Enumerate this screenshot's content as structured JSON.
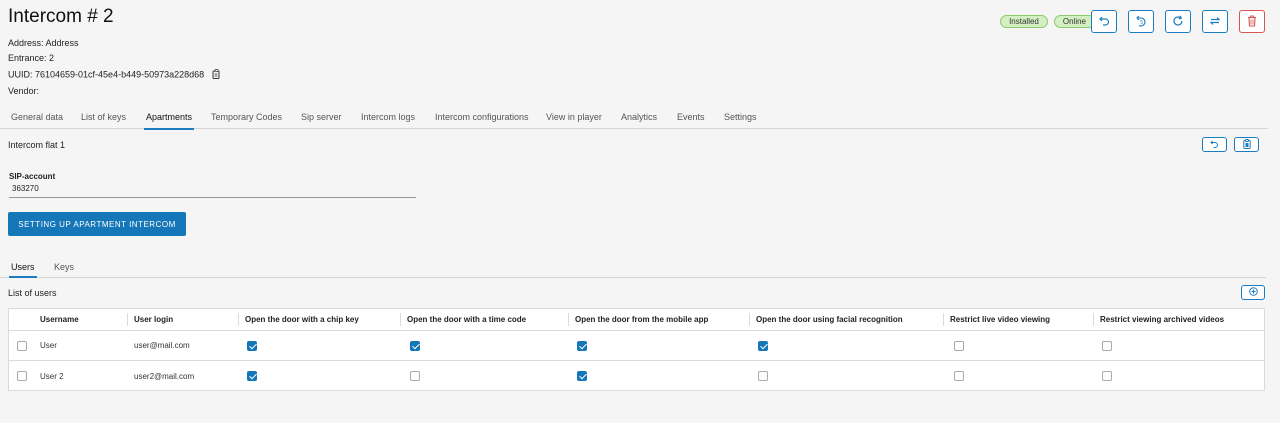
{
  "header": {
    "title": "Intercom # 2",
    "address": "Address: Address",
    "entrance": "Entrance: 2",
    "uuid": "UUID: 76104659-01cf-45e4-b449-50973a228d68",
    "vendor": "Vendor:",
    "status_installed": "Installed",
    "status_online": "Online"
  },
  "tabs": [
    {
      "label": "General data"
    },
    {
      "label": "List of keys"
    },
    {
      "label": "Apartments",
      "active": true
    },
    {
      "label": "Temporary Codes"
    },
    {
      "label": "Sip server"
    },
    {
      "label": "Intercom logs"
    },
    {
      "label": "Intercom configurations"
    },
    {
      "label": "View in player"
    },
    {
      "label": "Analytics"
    },
    {
      "label": "Events"
    },
    {
      "label": "Settings"
    }
  ],
  "flat": {
    "title": "Intercom flat 1",
    "sip_label": "SIP-account",
    "sip_value": "363270",
    "setup_button": "SETTING UP APARTMENT INTERCOM"
  },
  "subtabs": [
    {
      "label": "Users",
      "active": true
    },
    {
      "label": "Keys"
    }
  ],
  "users": {
    "list_title": "List of users",
    "columns": [
      "Username",
      "User login",
      "Open the door with a chip key",
      "Open the door with a time code",
      "Open the door from the mobile app",
      "Open the door using facial recognition",
      "Restrict live video viewing",
      "Restrict viewing archived videos"
    ],
    "rows": [
      {
        "username": "User",
        "login": "user@mail.com",
        "chip": true,
        "time_code": true,
        "mobile": true,
        "face": true,
        "restrict_live": false,
        "restrict_archive": false
      },
      {
        "username": "User 2",
        "login": "user2@mail.com",
        "chip": true,
        "time_code": false,
        "mobile": true,
        "face": false,
        "restrict_live": false,
        "restrict_archive": false
      }
    ]
  },
  "colors": {
    "accent": "#1577b8",
    "badge_bg": "#d4efc2",
    "danger": "#d9534f"
  },
  "icons": [
    "undo-icon",
    "reset-icon",
    "refresh-icon",
    "sync-icon",
    "trash-icon",
    "copy-icon",
    "add-icon",
    "clipboard-icon"
  ]
}
